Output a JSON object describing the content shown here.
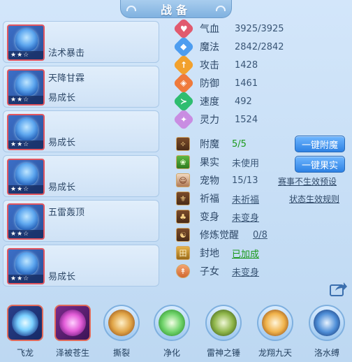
{
  "title": "战备",
  "cards": [
    {
      "top": "",
      "bottom": "法术暴击",
      "stars": "★★☆"
    },
    {
      "top": "天降甘霖",
      "bottom": "易成长",
      "stars": "★★☆"
    },
    {
      "top": "",
      "bottom": "易成长",
      "stars": "★★☆"
    },
    {
      "top": "",
      "bottom": "易成长",
      "stars": "★★☆"
    },
    {
      "top": "五雷轰顶",
      "bottom": "",
      "stars": "★★☆"
    },
    {
      "top": "",
      "bottom": "易成长",
      "stars": "★★☆"
    }
  ],
  "stats": [
    {
      "label": "气血",
      "value": "3925/3925",
      "color": "#e15a6f",
      "icon": "heart-icon"
    },
    {
      "label": "魔法",
      "value": "2842/2842",
      "color": "#4d9df0",
      "icon": "mana-icon"
    },
    {
      "label": "攻击",
      "value": "1428",
      "color": "#f2a12d",
      "icon": "sword-icon"
    },
    {
      "label": "防御",
      "value": "1461",
      "color": "#ef7a3c",
      "icon": "shield-icon"
    },
    {
      "label": "速度",
      "value": "492",
      "color": "#2fbd70",
      "icon": "speed-icon"
    },
    {
      "label": "灵力",
      "value": "1524",
      "color": "#c98de2",
      "icon": "spirit-icon"
    }
  ],
  "extras": [
    {
      "label": "附魔",
      "value": "5/5",
      "style": "green"
    },
    {
      "label": "果实",
      "value": "未使用",
      "style": ""
    },
    {
      "label": "宠物",
      "value": "15/13",
      "style": ""
    },
    {
      "label": "祈福",
      "value": "未祈福",
      "style": "ul"
    },
    {
      "label": "变身",
      "value": "未变身",
      "style": "ul"
    },
    {
      "label": "修炼觉醒",
      "value": "0/8",
      "style": "ul"
    },
    {
      "label": "封地",
      "value": "已加成",
      "style": "green ul"
    },
    {
      "label": "子女",
      "value": "未变身",
      "style": "ul"
    }
  ],
  "buttons": {
    "enchant": "一键附魔",
    "fruit": "一键果实"
  },
  "links": {
    "battle_effect": "赛事不生效预设",
    "status_rules": "状态生效规则"
  },
  "skills": [
    {
      "name": "飞龙",
      "style": "square",
      "color": "#7ad0ff"
    },
    {
      "name": "泽被苍生",
      "style": "square",
      "color": "#e45ed9"
    },
    {
      "name": "撕裂",
      "style": "round",
      "color": "#e0a446"
    },
    {
      "name": "净化",
      "style": "round",
      "color": "#6fd36a"
    },
    {
      "name": "雷神之锤",
      "style": "round",
      "color": "#8fb64a"
    },
    {
      "name": "龙翔九天",
      "style": "round",
      "color": "#f0b24a"
    },
    {
      "name": "洛水缚",
      "style": "round",
      "color": "#4f8fd8"
    }
  ]
}
